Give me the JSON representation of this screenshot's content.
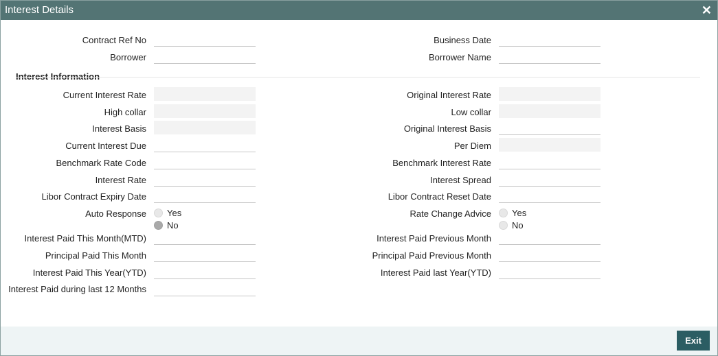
{
  "window": {
    "title": "Interest Details",
    "close_glyph": "✕"
  },
  "header_fields": {
    "contract_ref_no": {
      "label": "Contract Ref No",
      "value": ""
    },
    "business_date": {
      "label": "Business Date",
      "value": ""
    },
    "borrower": {
      "label": "Borrower",
      "value": ""
    },
    "borrower_name": {
      "label": "Borrower Name",
      "value": ""
    }
  },
  "interest_information": {
    "heading": "Interest Information",
    "current_interest_rate": {
      "label": "Current Interest Rate",
      "value": ""
    },
    "original_interest_rate": {
      "label": "Original Interest Rate",
      "value": ""
    },
    "high_collar": {
      "label": "High collar",
      "value": ""
    },
    "low_collar": {
      "label": "Low collar",
      "value": ""
    },
    "interest_basis": {
      "label": "Interest Basis",
      "value": ""
    },
    "original_interest_basis": {
      "label": "Original Interest Basis",
      "value": ""
    },
    "current_interest_due": {
      "label": "Current Interest Due",
      "value": ""
    },
    "per_diem": {
      "label": "Per Diem",
      "value": ""
    },
    "benchmark_rate_code": {
      "label": "Benchmark Rate Code",
      "value": ""
    },
    "benchmark_interest_rate": {
      "label": "Benchmark Interest Rate",
      "value": ""
    },
    "interest_rate": {
      "label": "Interest Rate",
      "value": ""
    },
    "interest_spread": {
      "label": "Interest Spread",
      "value": ""
    },
    "libor_contract_expiry_date": {
      "label": "Libor Contract Expiry Date",
      "value": ""
    },
    "libor_contract_reset_date": {
      "label": "Libor Contract Reset Date",
      "value": ""
    },
    "auto_response": {
      "label": "Auto Response",
      "yes": "Yes",
      "no": "No",
      "selected": "No"
    },
    "rate_change_advice": {
      "label": "Rate Change Advice",
      "yes": "Yes",
      "no": "No",
      "selected": "none"
    },
    "interest_paid_this_month": {
      "label": "Interest Paid This Month(MTD)",
      "value": ""
    },
    "interest_paid_previous_month": {
      "label": "Interest Paid Previous Month",
      "value": ""
    },
    "principal_paid_this_month": {
      "label": "Principal Paid This Month",
      "value": ""
    },
    "principal_paid_previous_month": {
      "label": "Principal Paid Previous Month",
      "value": ""
    },
    "interest_paid_this_year": {
      "label": "Interest Paid This Year(YTD)",
      "value": ""
    },
    "interest_paid_last_year": {
      "label": "Interest Paid last Year(YTD)",
      "value": ""
    },
    "interest_paid_last_12_months": {
      "label": "Interest Paid during last 12 Months",
      "value": ""
    }
  },
  "footer": {
    "exit_label": "Exit"
  },
  "colors": {
    "titlebar": "#537474",
    "exit_button": "#2b5d63",
    "footer": "#eef4f5"
  }
}
